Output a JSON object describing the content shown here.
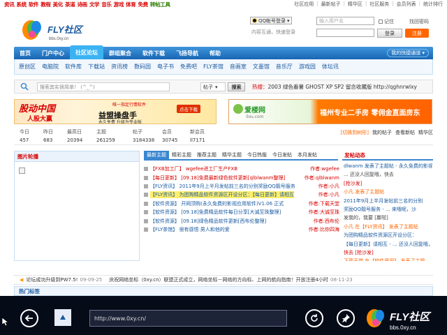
{
  "top_nav": {
    "channels": [
      "资讯",
      "系统",
      "软件",
      "教程",
      "美化",
      "茶道",
      "诗画",
      "文学",
      "音乐",
      "游戏",
      "体育",
      "免费",
      "转帖工具"
    ],
    "right_links": [
      "社区应用",
      "最新帖子",
      "精华区",
      "社区服务",
      "会员列表",
      "统计排行"
    ]
  },
  "logo": {
    "text": "FLY社区",
    "sub": "bbs.0xy.cn"
  },
  "login": {
    "qq_button": "QQ帐号登录",
    "qq_hint": "内容互通，快速登录",
    "username_placeholder": "输入用户名",
    "password_placeholder": "",
    "remember": "记住",
    "forgot": "找回密码",
    "login_button": "登录",
    "register_button": "注册"
  },
  "main_nav": {
    "items": [
      "首页",
      "门户中心",
      "社区论坛",
      "群组聚合",
      "软件下载",
      "飞扬导航",
      "帮助"
    ],
    "active_index": 2,
    "quick": "我的快捷通道 ▾"
  },
  "sub_nav": [
    "原创区",
    "电脑院",
    "软件库",
    "下载站",
    "资讯榜",
    "数码园",
    "电子书",
    "免费吧",
    "FLY茶馆",
    "音画室",
    "文墨馆",
    "音乐厅",
    "游戏园",
    "体坛讯"
  ],
  "search": {
    "placeholder": "搜索其实很简单！ (^_^)",
    "scope": "帖子",
    "button": "搜索",
    "hot_label": "热搜：",
    "hot_terms": "2003   绿色番薯 GHOST XP SP2 留念收藏版   http://qghnrwlxy"
  },
  "banners": {
    "left": {
      "a": "股动中国",
      "b": "人股大赢",
      "c": "益盟操盘手",
      "d": "唯一指定行情软件",
      "e": "点击下载",
      "f": "永久免费  升级为专业版"
    },
    "right": {
      "brand": "爱楼网",
      "domain": "ilou.com",
      "slogan": "福州专业二手房 零佣金直面房东"
    }
  },
  "stats": {
    "items": [
      {
        "k": "今日",
        "v": "457"
      },
      {
        "k": "昨日",
        "v": "683"
      },
      {
        "k": "最高日",
        "v": "20394"
      },
      {
        "k": "主题",
        "v": "261259"
      },
      {
        "k": "帖子",
        "v": "3184338"
      },
      {
        "k": "会员",
        "v": "30745"
      },
      {
        "k": "新会员",
        "v": "ll7171"
      }
    ],
    "right": [
      "[切换到树形]",
      "我的帖子",
      "查看新帖",
      "精华区"
    ]
  },
  "image_panel": {
    "title": "图片轮播"
  },
  "tabs": {
    "items": [
      "最新主题",
      "精彩主题",
      "推荐主题",
      "精华主题",
      "今日热版",
      "今日发帖",
      "本月发帖"
    ],
    "active_index": 0
  },
  "threads": [
    {
      "cat": "",
      "title": "【FXB加工厂】 wgefee进工厂生产FXB",
      "style": "red",
      "author": "作者:wgefee"
    },
    {
      "cat": "",
      "title": "【每日更新】 [09.18]免费最新绿色软件更新[qlblwanm整理]",
      "style": "red",
      "author": "作者:qlblwanm"
    },
    {
      "cat": "",
      "title": "【FLY资讯】 2011年9月上半月发帖前三名的分别奖励QQ靓号服务",
      "style": "blue",
      "author": "作者:小凡"
    },
    {
      "cat": "",
      "title": "【FLY资讯】 为团购精品软件资源区开设分区：【每日更新】请相互",
      "style": "hl",
      "author": "作者:小凡"
    },
    {
      "cat": "",
      "title": "【软件资源】 开网顶购(永久免费的影视应用软件)V1.06 正式",
      "style": "blue",
      "author": "作者:下载天堂"
    },
    {
      "cat": "",
      "title": "【软件资源】 [09.18]免费精品软件每日分享[大诚至珠整理]",
      "style": "blue",
      "author": "作者:大诚至珠"
    },
    {
      "cat": "",
      "title": "【软件资源】 [09.18]绿色精品软件更新[西布伦整理]",
      "style": "blue",
      "author": "作者:西布伦"
    },
    {
      "cat": "",
      "title": "【FLY茶馆】 很有感悟  男人和他的爱",
      "style": "blue",
      "author": "作者:比你四海"
    }
  ],
  "activity": {
    "title": "发帖动态",
    "lines": [
      {
        "t": "dlwanm 发表了主题帖 - 永久免费的影视...",
        "c": "b"
      },
      {
        "t": "... 还没人回复哦，快去",
        "c": ""
      },
      {
        "t": "[抢沙发]",
        "c": "r"
      },
      {
        "t": "小凡 发表了主题帖",
        "c": "u"
      },
      {
        "t": "2011年9月上半月发帖前三名的分别",
        "c": "b"
      },
      {
        "t": "奖励QQ靓号服务 - ... 来哦呢，沙",
        "c": "b"
      },
      {
        "t": "发我的，我要 [赢啦]",
        "c": ""
      },
      {
        "t": "小凡 在【FLY资讯】 发表了主题帖",
        "c": "u"
      },
      {
        "t": "为团购精品软件资源区开设分区：",
        "c": "b"
      },
      {
        "t": "【每日更新】请相互 - ... 还没人回复哦，",
        "c": "b"
      },
      {
        "t": "快去 [抢沙发]",
        "c": "r"
      },
      {
        "t": "下载天堂 在【软件资源】 发表了主题",
        "c": "u"
      },
      {
        "t": "帖 开网顶购(永久免费的影视应用软件)",
        "c": "b"
      }
    ]
  },
  "scroller": [
    {
      "t": "论坛成功升级到PW7.5!",
      "d": "09-09-25"
    },
    {
      "t": "庆祝网络坐标（0xy.cn）联盟正式成立，网络坐标－网络的方向标、上网的航向指南！开放注册4小时",
      "d": "08-11-23"
    }
  ],
  "hot_tags": "热门标签",
  "browser": {
    "url": "http://www.0xy.cn/"
  },
  "watermark": {
    "text": "FLY社区",
    "sub": "bbs.0xy.cn"
  },
  "colors": {
    "accent": "#1866b4",
    "nav_active": "#3bb3f2",
    "red": "#d80000",
    "orange": "#ff6600"
  }
}
